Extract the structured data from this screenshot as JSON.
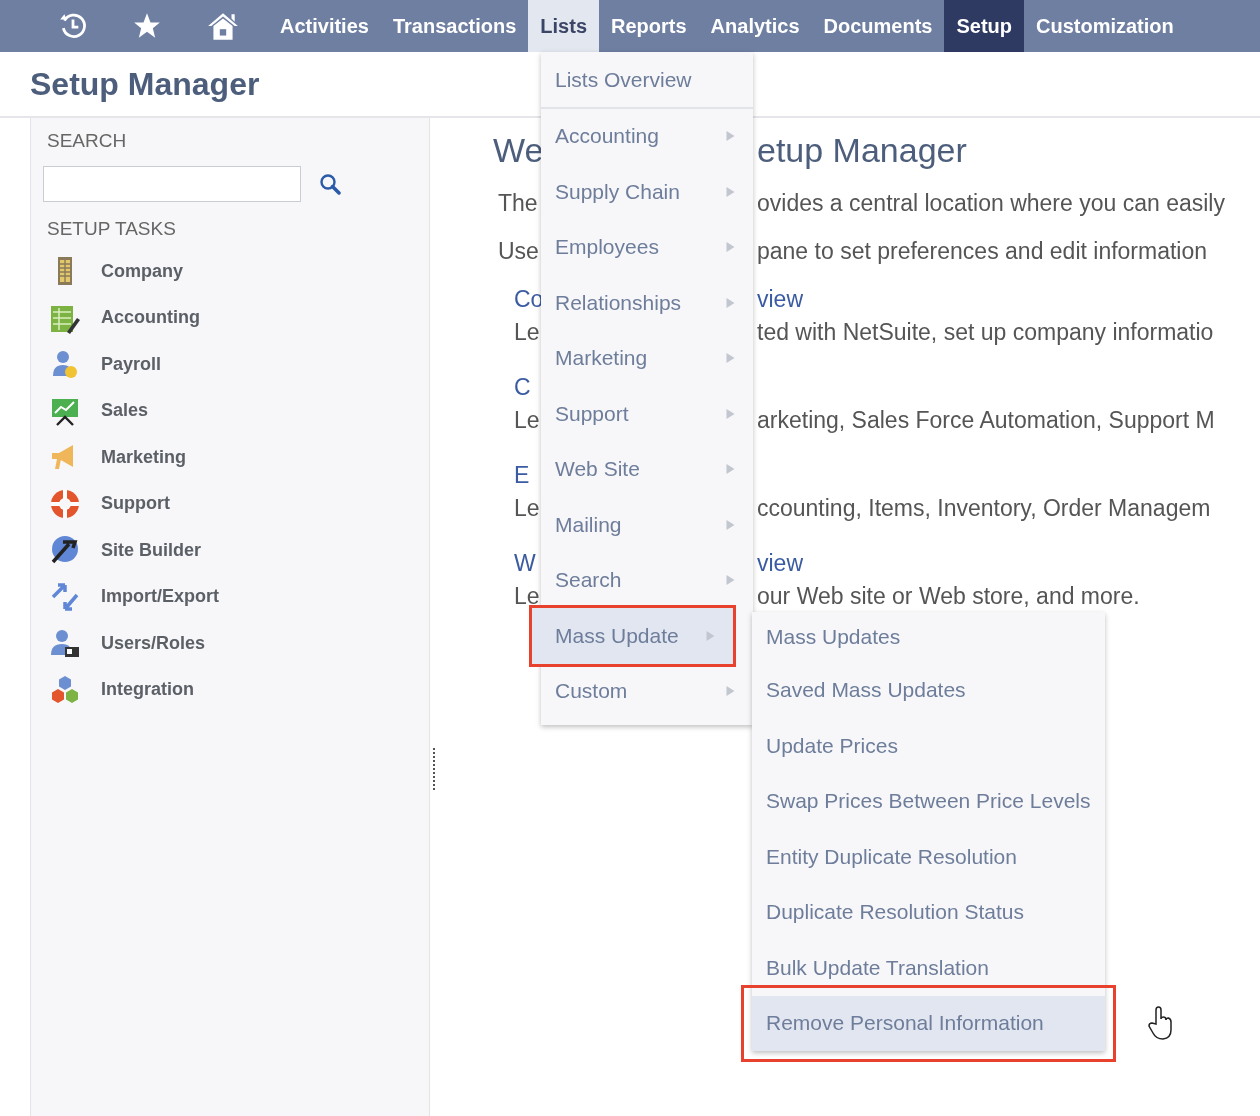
{
  "nav": {
    "items": [
      {
        "label": "Activities",
        "selected": false,
        "open": false
      },
      {
        "label": "Transactions",
        "selected": false,
        "open": false
      },
      {
        "label": "Lists",
        "selected": false,
        "open": true
      },
      {
        "label": "Reports",
        "selected": false,
        "open": false
      },
      {
        "label": "Analytics",
        "selected": false,
        "open": false
      },
      {
        "label": "Documents",
        "selected": false,
        "open": false
      },
      {
        "label": "Setup",
        "selected": true,
        "open": false
      },
      {
        "label": "Customization",
        "selected": false,
        "open": false
      }
    ]
  },
  "page_title": "Setup Manager",
  "sidebar": {
    "search_label": "SEARCH",
    "tasks_label": "SETUP TASKS",
    "tasks": [
      {
        "label": "Company"
      },
      {
        "label": "Accounting"
      },
      {
        "label": "Payroll"
      },
      {
        "label": "Sales"
      },
      {
        "label": "Marketing"
      },
      {
        "label": "Support"
      },
      {
        "label": "Site Builder"
      },
      {
        "label": "Import/Export"
      },
      {
        "label": "Users/Roles"
      },
      {
        "label": "Integration"
      }
    ]
  },
  "content": {
    "lines": [
      {
        "kind": "heading",
        "left": "We",
        "right": "etup Manager"
      },
      {
        "kind": "text",
        "left": "The",
        "right": "ovides a central location where you can easily"
      },
      {
        "kind": "text",
        "left": "Use",
        "right": "pane to set preferences and edit information"
      },
      {
        "kind": "link",
        "left": "Co",
        "right": "view"
      },
      {
        "kind": "desc",
        "left": "Le",
        "right": "ted with NetSuite, set up company informatio"
      },
      {
        "kind": "link",
        "left": "C"
      },
      {
        "kind": "desc",
        "left": "Le",
        "right": "arketing, Sales Force Automation, Support M"
      },
      {
        "kind": "link",
        "left": "E"
      },
      {
        "kind": "desc",
        "left": "Le",
        "right": "ccounting, Items, Inventory, Order Managem"
      },
      {
        "kind": "link",
        "left": "W",
        "right": "view"
      },
      {
        "kind": "desc",
        "left": "Le",
        "right": "our Web site or Web store, and more."
      }
    ]
  },
  "menu": {
    "items": [
      {
        "label": "Lists Overview",
        "submenu": false,
        "highlighted": false,
        "callout": false
      },
      {
        "label": "Accounting",
        "submenu": true,
        "highlighted": false,
        "callout": false
      },
      {
        "label": "Supply Chain",
        "submenu": true,
        "highlighted": false,
        "callout": false
      },
      {
        "label": "Employees",
        "submenu": true,
        "highlighted": false,
        "callout": false
      },
      {
        "label": "Relationships",
        "submenu": true,
        "highlighted": false,
        "callout": false
      },
      {
        "label": "Marketing",
        "submenu": true,
        "highlighted": false,
        "callout": false
      },
      {
        "label": "Support",
        "submenu": true,
        "highlighted": false,
        "callout": false
      },
      {
        "label": "Web Site",
        "submenu": true,
        "highlighted": false,
        "callout": false
      },
      {
        "label": "Mailing",
        "submenu": true,
        "highlighted": false,
        "callout": false
      },
      {
        "label": "Search",
        "submenu": true,
        "highlighted": false,
        "callout": false
      },
      {
        "label": "Mass Update",
        "submenu": true,
        "highlighted": true,
        "callout": true
      },
      {
        "label": "Custom",
        "submenu": true,
        "highlighted": false,
        "callout": false
      }
    ]
  },
  "submenu": {
    "items": [
      {
        "label": "Mass Updates",
        "highlighted": false,
        "callout": false
      },
      {
        "label": "Saved Mass Updates",
        "highlighted": false,
        "callout": false
      },
      {
        "label": "Update Prices",
        "highlighted": false,
        "callout": false
      },
      {
        "label": "Swap Prices Between Price Levels",
        "highlighted": false,
        "callout": false
      },
      {
        "label": "Entity Duplicate Resolution",
        "highlighted": false,
        "callout": false
      },
      {
        "label": "Duplicate Resolution Status",
        "highlighted": false,
        "callout": false
      },
      {
        "label": "Bulk Update Translation",
        "highlighted": false,
        "callout": false
      },
      {
        "label": "Remove Personal Information",
        "highlighted": true,
        "callout": true
      }
    ]
  }
}
